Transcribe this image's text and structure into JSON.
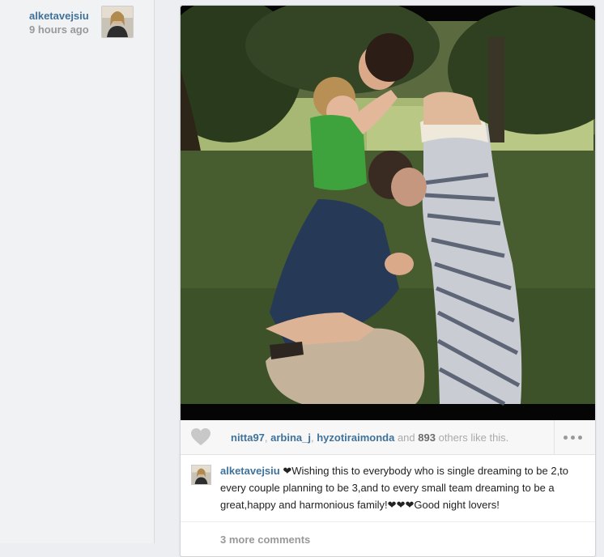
{
  "author": {
    "username": "alketavejsiu",
    "time_ago": "9 hours ago",
    "avatar_icon": "user-avatar"
  },
  "likes": {
    "users": [
      "nitta97",
      "arbina_j",
      "hyzotiraimonda"
    ],
    "sep": ", ",
    "and": "and",
    "count": "893",
    "suffix": "others like this.",
    "heart_icon": "heart-icon",
    "more_icon": "more-options-icon"
  },
  "caption": {
    "username": "alketavejsiu",
    "text": "❤Wishing this to everybody who is single dreaming to be 2,to every couple planning to be 3,and to every small team dreaming to be a great,happy and harmonious family!❤❤❤Good night lovers!"
  },
  "comments": {
    "more_label": "3 more comments"
  },
  "colors": {
    "link": "#3f729b",
    "muted": "#999999",
    "background": "#eceef1"
  }
}
